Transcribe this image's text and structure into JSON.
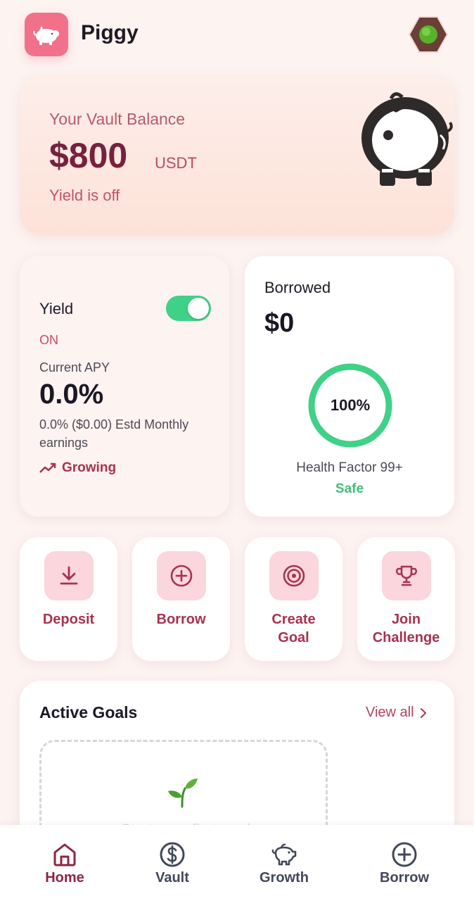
{
  "header": {
    "app_name": "Piggy",
    "logo_icon": "pig-icon",
    "avatar_icon": "avatar-icon"
  },
  "vault": {
    "label": "Your Vault Balance",
    "amount": "$800",
    "unit": "USDT",
    "status": "Yield is off",
    "illustration": "piggy-bank-icon"
  },
  "yield": {
    "title": "Yield",
    "toggle_on": true,
    "state": "ON",
    "apy_label": "Current APY",
    "apy_value": "0.0%",
    "estimate": "0.0% ($0.00) Estd Monthly earnings",
    "trend_label": "Growing"
  },
  "borrowed": {
    "title": "Borrowed",
    "amount": "$0",
    "gauge_percent": 100,
    "gauge_text": "100%",
    "health_label": "Health Factor 99+",
    "health_status": "Safe"
  },
  "actions": [
    {
      "label": "Deposit",
      "icon": "download-icon"
    },
    {
      "label": "Borrow",
      "icon": "plus-circle-icon"
    },
    {
      "label": "Create Goal",
      "icon": "target-icon"
    },
    {
      "label": "Join Challenge",
      "icon": "trophy-icon"
    }
  ],
  "goals": {
    "title": "Active Goals",
    "view_all": "View all",
    "empty_text": "Start your first goal"
  },
  "tabbar": [
    {
      "label": "Home",
      "icon": "home-icon",
      "active": true
    },
    {
      "label": "Vault",
      "icon": "dollar-icon",
      "active": false
    },
    {
      "label": "Growth",
      "icon": "piggy-icon",
      "active": false
    },
    {
      "label": "Borrow",
      "icon": "plus-circle-icon",
      "active": false
    }
  ],
  "colors": {
    "background": "#fdf3f1",
    "brand_pink": "#f2718a",
    "accent_maroon": "#8c2641",
    "toggle_green": "#3fd187",
    "safe_green": "#3fbf7a"
  }
}
